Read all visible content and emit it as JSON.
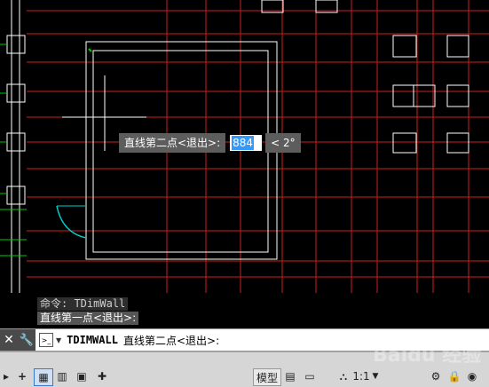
{
  "drawing": {
    "dynamic_prompt_label": "直线第二点<退出>:",
    "dynamic_input_value": "884",
    "dynamic_angle": "< 2°"
  },
  "history": {
    "line1": "命令: TDimWall",
    "line2": "直线第一点<退出>:"
  },
  "command_line": {
    "close_glyph": "✕",
    "wrench_glyph": "🔧",
    "command_name": "TDIMWALL",
    "prompt": "直线第二点<退出>:"
  },
  "status_bar": {
    "plus_glyph": "+",
    "model_label": "模型",
    "scale_label": "1:1",
    "scale_glyph": "▼"
  },
  "watermark": "Baidu 经验",
  "colors": {
    "canvas_bg": "#000000",
    "grid_line": "#cc1f1f",
    "wall_line": "#ffffff",
    "window_line": "#00cccc",
    "highlight": "#3399ff"
  }
}
